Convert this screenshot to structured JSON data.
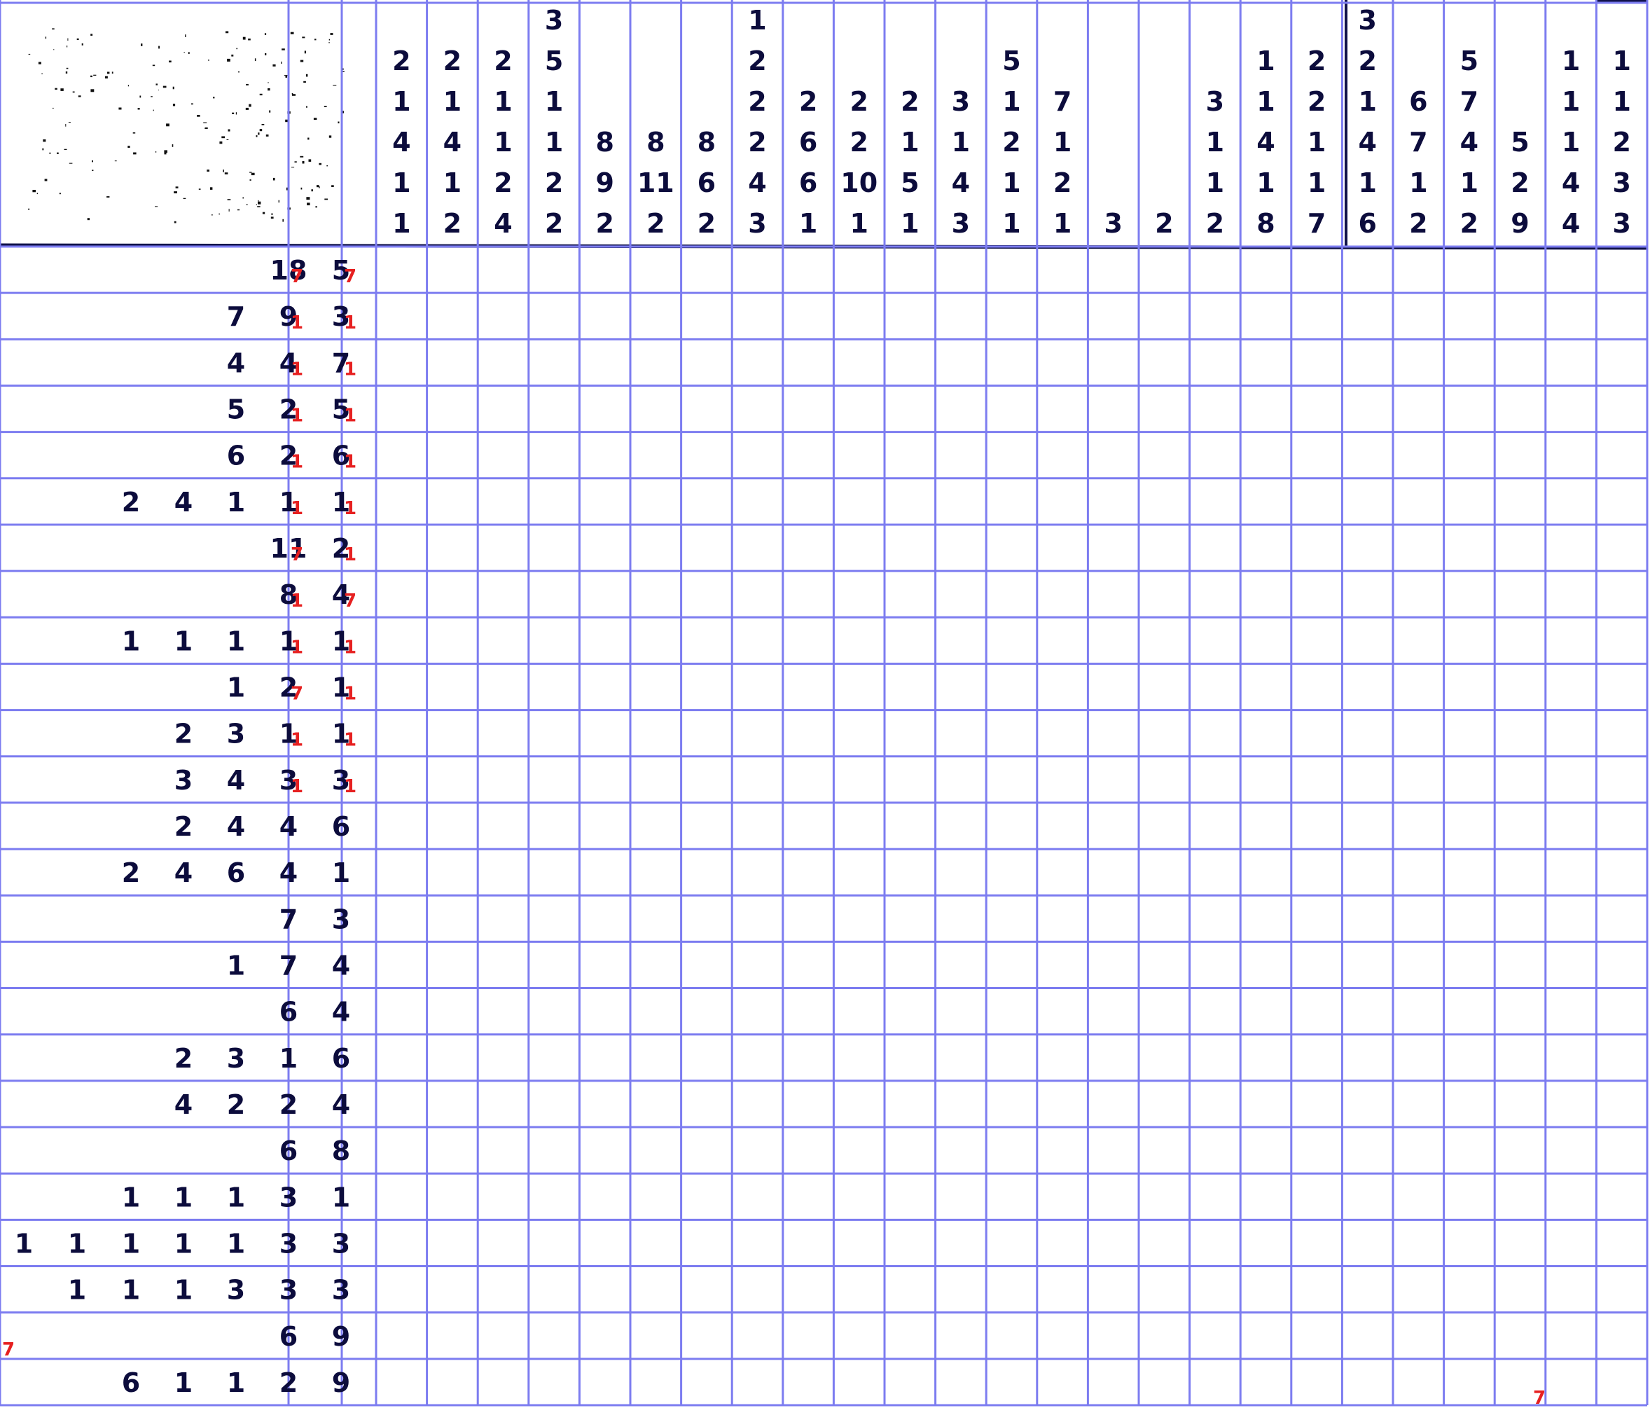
{
  "puzzle": {
    "rows": 25,
    "cols": 25,
    "column_clues": [
      [
        "2",
        "1",
        "4",
        "1",
        "1"
      ],
      [
        "2",
        "1",
        "4",
        "1",
        "2"
      ],
      [
        "2",
        "1",
        "1",
        "2",
        "4"
      ],
      [
        "3",
        "5",
        "1",
        "1",
        "2",
        "2"
      ],
      [
        "8",
        "9",
        "2"
      ],
      [
        "8",
        "11",
        "2"
      ],
      [
        "8",
        "6",
        "2"
      ],
      [
        "1",
        "2",
        "2",
        "2",
        "4",
        "3"
      ],
      [
        "2",
        "6",
        "6",
        "1"
      ],
      [
        "2",
        "2",
        "10",
        "1"
      ],
      [
        "2",
        "1",
        "5",
        "1"
      ],
      [
        "3",
        "1",
        "4",
        "3"
      ],
      [
        "5",
        "1",
        "2",
        "1",
        "1"
      ],
      [
        "7",
        "1",
        "2",
        "1"
      ],
      [
        "3"
      ],
      [
        "2"
      ],
      [
        "3",
        "1",
        "1",
        "2"
      ],
      [
        "1",
        "1",
        "4",
        "1",
        "8"
      ],
      [
        "2",
        "2",
        "1",
        "1",
        "7"
      ],
      [
        "3",
        "2",
        "1",
        "4",
        "1",
        "6"
      ],
      [
        "6",
        "7",
        "1",
        "2"
      ],
      [
        "5",
        "7",
        "4",
        "1",
        "2"
      ],
      [
        "5",
        "2",
        "9"
      ],
      [
        "1",
        "1",
        "1",
        "4",
        "4"
      ],
      [
        "1",
        "1",
        "2",
        "3",
        "3"
      ]
    ],
    "row_clues": [
      [
        "18",
        "5"
      ],
      [
        "7",
        "9",
        "3"
      ],
      [
        "4",
        "4",
        "7"
      ],
      [
        "5",
        "2",
        "5"
      ],
      [
        "6",
        "2",
        "6"
      ],
      [
        "2",
        "4",
        "1",
        "1",
        "1"
      ],
      [
        "11",
        "2"
      ],
      [
        "8",
        "4"
      ],
      [
        "1",
        "1",
        "1",
        "1",
        "1"
      ],
      [
        "1",
        "2",
        "1"
      ],
      [
        "2",
        "3",
        "1",
        "1"
      ],
      [
        "3",
        "4",
        "3",
        "3"
      ],
      [
        "2",
        "4",
        "4",
        "6"
      ],
      [
        "2",
        "4",
        "6",
        "4",
        "1"
      ],
      [
        "7",
        "3"
      ],
      [
        "1",
        "7",
        "4"
      ],
      [
        "6",
        "4"
      ],
      [
        "2",
        "3",
        "1",
        "6"
      ],
      [
        "4",
        "2",
        "2",
        "4"
      ],
      [
        "6",
        "8"
      ],
      [
        "1",
        "1",
        "1",
        "3",
        "1"
      ],
      [
        "1",
        "1",
        "1",
        "1",
        "1",
        "3",
        "3"
      ],
      [
        "1",
        "1",
        "1",
        "3",
        "3",
        "3"
      ],
      [
        "6",
        "9"
      ],
      [
        "6",
        "1",
        "1",
        "2",
        "9"
      ]
    ],
    "overlay_digits": [
      "7",
      "7",
      "1",
      "1",
      "1",
      "1",
      "1",
      "1",
      "1",
      "1",
      "1",
      "1",
      "7",
      "1",
      "1",
      "7",
      "1",
      "1",
      "7",
      "1",
      "1",
      "1",
      "1",
      "1",
      "7",
      "7"
    ]
  },
  "colors": {
    "background": "#ffffff",
    "grid_line": "#7c7cf0",
    "clue_ink": "#0c0c3c",
    "overlay_digit": "#e62020",
    "scan_border": "#10124a"
  }
}
